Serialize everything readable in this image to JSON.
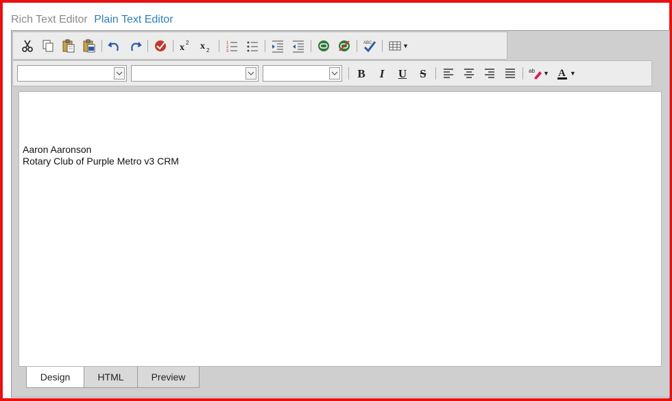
{
  "mode_switch": {
    "rich_label": "Rich Text Editor",
    "plain_label": "Plain Text Editor"
  },
  "toolbar1": {
    "buttons": [
      {
        "name": "cut-icon",
        "group": 1
      },
      {
        "name": "copy-icon",
        "group": 1
      },
      {
        "name": "paste-icon",
        "group": 1
      },
      {
        "name": "paste-from-word-icon",
        "group": 1
      },
      {
        "name": "undo-icon",
        "group": 2
      },
      {
        "name": "redo-icon",
        "group": 2
      },
      {
        "name": "spell-check-icon",
        "group": 3
      },
      {
        "name": "superscript-icon",
        "group": 4
      },
      {
        "name": "subscript-icon",
        "group": 4
      },
      {
        "name": "ordered-list-icon",
        "group": 5
      },
      {
        "name": "unordered-list-icon",
        "group": 5
      },
      {
        "name": "indent-icon",
        "group": 6
      },
      {
        "name": "outdent-icon",
        "group": 6
      },
      {
        "name": "insert-link-icon",
        "group": 7
      },
      {
        "name": "remove-link-icon",
        "group": 7
      },
      {
        "name": "ajax-spellcheck-icon",
        "group": 8
      },
      {
        "name": "insert-table-icon",
        "group": 9
      }
    ]
  },
  "toolbar2": {
    "font_name": "",
    "font_size": "",
    "paragraph_style": "",
    "format_labels": {
      "bold": "B",
      "italic": "I",
      "underline": "U",
      "strike": "S"
    },
    "font_color_label": "A",
    "highlight_label": "ab"
  },
  "content": {
    "line1": "Aaron Aaronson",
    "line2": "Rotary Club of Purple Metro v3 CRM"
  },
  "tabs": [
    {
      "label": "Design",
      "active": true
    },
    {
      "label": "HTML",
      "active": false
    },
    {
      "label": "Preview",
      "active": false
    }
  ],
  "colors": {
    "frame_border": "#e81010",
    "mode_link": "#2f7fb9",
    "toolbar_bg": "#ececec",
    "editor_bg": "#cfcfcf"
  }
}
